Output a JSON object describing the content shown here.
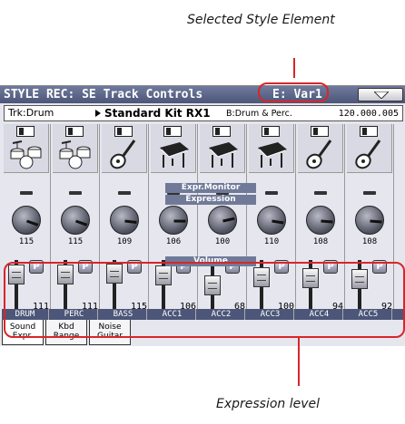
{
  "callouts": {
    "top": "Selected Style Element",
    "bottom": "Expression level"
  },
  "screen": {
    "title": "STYLE REC: SE Track Controls",
    "element": "E: Var1",
    "menu_icon": "triangle-down-icon",
    "track_label": "Trk:Drum",
    "kit_name": "Standard Kit RX1",
    "bank": "B:Drum & Perc.",
    "program_number": "120.000.005",
    "band_expr_monitor": "Expr.Monitor",
    "band_expression": "Expression",
    "band_volume": "Volume",
    "p_label": "P"
  },
  "tracks": [
    {
      "name": "DRUM",
      "icon": "drum-kit-icon",
      "expression": "115",
      "volume": "111",
      "volume_level": 0.87
    },
    {
      "name": "PERC",
      "icon": "drum-kit-icon",
      "expression": "115",
      "volume": "111",
      "volume_level": 0.87
    },
    {
      "name": "BASS",
      "icon": "guitar-icon",
      "expression": "109",
      "volume": "115",
      "volume_level": 0.9
    },
    {
      "name": "ACC1",
      "icon": "piano-icon",
      "expression": "106",
      "volume": "106",
      "volume_level": 0.83
    },
    {
      "name": "ACC2",
      "icon": "piano-icon",
      "expression": "100",
      "volume": "68",
      "volume_level": 0.54
    },
    {
      "name": "ACC3",
      "icon": "piano-icon",
      "expression": "110",
      "volume": "100",
      "volume_level": 0.79
    },
    {
      "name": "ACC4",
      "icon": "guitar-icon",
      "expression": "108",
      "volume": "94",
      "volume_level": 0.74
    },
    {
      "name": "ACC5",
      "icon": "guitar-icon",
      "expression": "108",
      "volume": "92",
      "volume_level": 0.72
    }
  ],
  "tabs": [
    {
      "label": "Sound Expr.",
      "active": true
    },
    {
      "label": "Kbd Range",
      "active": false
    },
    {
      "label": "Noise Guitar",
      "active": false
    }
  ],
  "colors": {
    "highlight": "#d9252a",
    "title_bar": "#5d6789"
  }
}
